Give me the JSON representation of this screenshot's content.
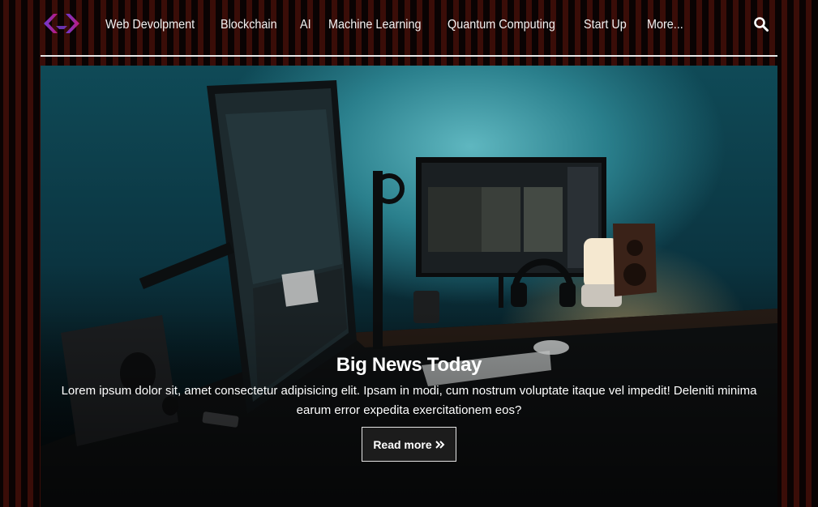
{
  "nav": {
    "logo_icon": "code-brackets-logo",
    "links": [
      "Web Devolpment",
      "Blockchain",
      "AI",
      "Machine Learning",
      "Quantum Computing",
      "Start Up",
      "More..."
    ],
    "search_icon": "search-icon"
  },
  "hero": {
    "title": "Big News Today",
    "text": "Lorem ipsum dolor sit, amet consectetur adipisicing elit. Ipsam in modi, cum nostrum voluptate itaque vel impedit! Deleniti minima earum error expedita exercitationem eos?",
    "button_label": "Read more",
    "button_icon": "double-chevron-right-icon"
  },
  "colors": {
    "background": "#0a0303",
    "accent_stripe": "#3a0d08",
    "logo_gradient_start": "#7b2ff7",
    "logo_gradient_end": "#c2187a",
    "button_background": "#1c1c1c"
  }
}
